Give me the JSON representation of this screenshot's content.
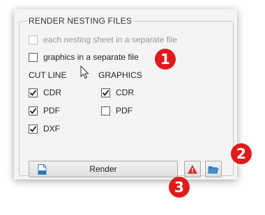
{
  "group": {
    "title": "RENDER NESTING FILES"
  },
  "options": [
    {
      "label": "each nesting sheet in a separate file",
      "checked": false,
      "disabled": true
    },
    {
      "label": "graphics in a separate file",
      "checked": false,
      "disabled": false
    }
  ],
  "cut_line": {
    "heading": "CUT LINE",
    "items": [
      {
        "label": "CDR",
        "checked": true
      },
      {
        "label": "PDF",
        "checked": true
      },
      {
        "label": "DXF",
        "checked": true
      }
    ]
  },
  "graphics": {
    "heading": "GRAPHICS",
    "items": [
      {
        "label": "CDR",
        "checked": true
      },
      {
        "label": "PDF",
        "checked": false
      }
    ]
  },
  "buttons": {
    "render_label": "Render",
    "render_icon": "cdr-file-icon",
    "warning_icon": "warning-icon",
    "folder_icon": "open-folder-icon"
  },
  "callouts": [
    "1",
    "2",
    "3"
  ],
  "colors": {
    "callout": "#e01b1b",
    "folder": "#2a7ab9",
    "checkmark": "#1a1a1a"
  }
}
